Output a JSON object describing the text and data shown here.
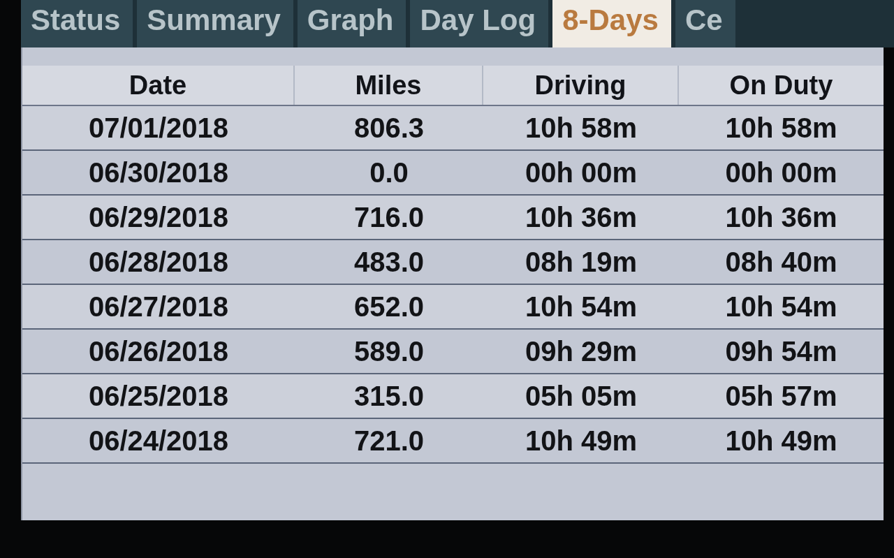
{
  "tabs": [
    {
      "label": "Status",
      "selected": false
    },
    {
      "label": "Summary",
      "selected": false
    },
    {
      "label": "Graph",
      "selected": false
    },
    {
      "label": "Day Log",
      "selected": false
    },
    {
      "label": "8-Days",
      "selected": true
    },
    {
      "label": "Ce",
      "selected": false
    }
  ],
  "table": {
    "columns": [
      "Date",
      "Miles",
      "Driving",
      "On Duty"
    ],
    "rows": [
      [
        "07/01/2018",
        "806.3",
        "10h 58m",
        "10h 58m"
      ],
      [
        "06/30/2018",
        "0.0",
        "00h 00m",
        "00h 00m"
      ],
      [
        "06/29/2018",
        "716.0",
        "10h 36m",
        "10h 36m"
      ],
      [
        "06/28/2018",
        "483.0",
        "08h 19m",
        "08h 40m"
      ],
      [
        "06/27/2018",
        "652.0",
        "10h 54m",
        "10h 54m"
      ],
      [
        "06/26/2018",
        "589.0",
        "09h 29m",
        "09h 54m"
      ],
      [
        "06/25/2018",
        "315.0",
        "05h 05m",
        "05h 57m"
      ],
      [
        "06/24/2018",
        "721.0",
        "10h 49m",
        "10h 49m"
      ]
    ]
  }
}
